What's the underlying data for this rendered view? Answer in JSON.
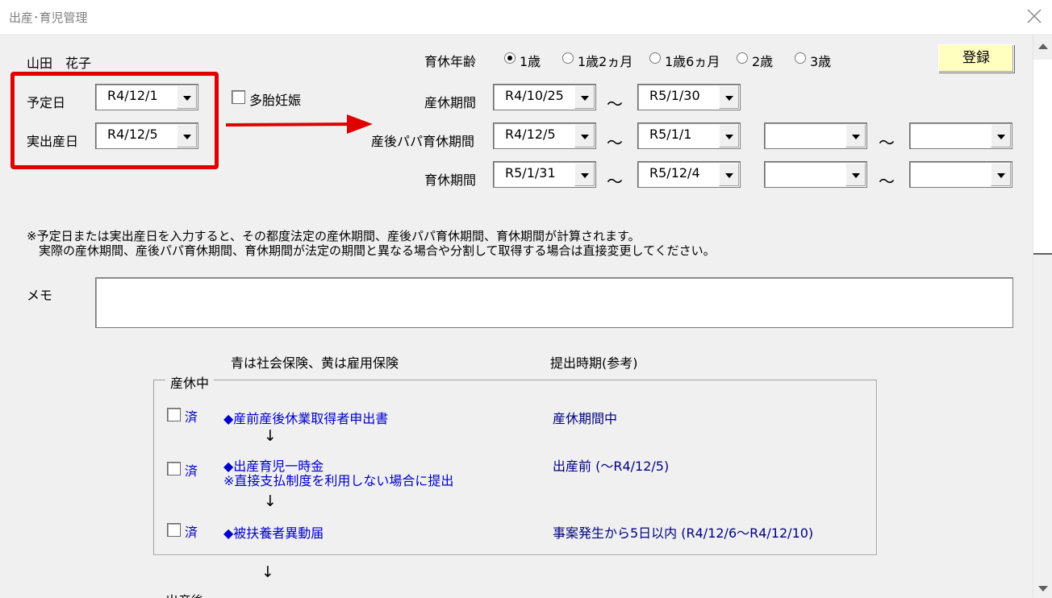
{
  "window": {
    "title": "出産･育児管理"
  },
  "person": {
    "name": "山田　花子"
  },
  "due_date": {
    "label": "予定日",
    "value": "R4/12/1"
  },
  "birth_date": {
    "label": "実出産日",
    "value": "R4/12/5"
  },
  "multiple_pregnancy": {
    "label": "多胎妊娠",
    "checked": false
  },
  "childcare_age": {
    "label": "育休年齢",
    "options": [
      "1歳",
      "1歳2ヵ月",
      "1歳6ヵ月",
      "2歳",
      "3歳"
    ],
    "selected": "1歳"
  },
  "register_button": {
    "label": "登録"
  },
  "maternity_leave": {
    "label": "産休期間",
    "from": "R4/10/25",
    "to": "R5/1/30"
  },
  "papa_leave": {
    "label": "産後パパ育休期間",
    "from": "R4/12/5",
    "to": "R5/1/1",
    "from2": "",
    "to2": ""
  },
  "childcare_leave": {
    "label": "育休期間",
    "from": "R5/1/31",
    "to": "R5/12/4",
    "from2": "",
    "to2": ""
  },
  "tilde": "～",
  "notice": {
    "line1": "※予定日または実出産日を入力すると、その都度法定の産休期間、産後パパ育休期間、育休期間が計算されます。",
    "line2": "　実際の産休期間、産後パパ育休期間、育休期間が法定の期間と異なる場合や分割して取得する場合は直接変更してください。"
  },
  "memo": {
    "label": "メモ",
    "value": ""
  },
  "legend": {
    "insurance": "青は社会保険、黄は雇用保険",
    "timing": "提出時期(参考)"
  },
  "group_maternity": {
    "title": "産休中",
    "done_label": "済",
    "arrow": "↓",
    "items": [
      {
        "name": "◆産前産後休業取得者申出書",
        "note": "",
        "timing": "産休期間中"
      },
      {
        "name": "◆出産育児一時金",
        "note": "※直接支払制度を利用しない場合に提出",
        "timing": "出産前 (～R4/12/5)"
      },
      {
        "name": "◆被扶養者異動届",
        "note": "",
        "timing": "事案発生から5日以内 (R4/12/6～R4/12/10)"
      }
    ]
  },
  "next_group": {
    "title": "出産後"
  }
}
